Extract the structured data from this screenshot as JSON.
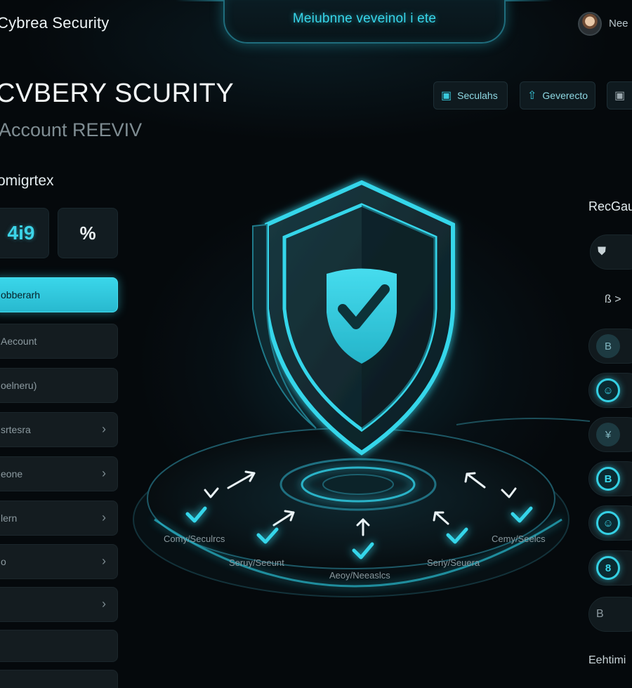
{
  "brand": "Cybrea Security",
  "top_title": "Meiubnne veveinol i ete",
  "user": {
    "name": "Nee",
    "avatar_icon": "user-avatar"
  },
  "header": {
    "title": "CVBERY SCURITY",
    "subtitle": "Account REEVIV",
    "buttons": [
      {
        "label": "Seculahs",
        "icon": "lock-icon"
      },
      {
        "label": "Geverecto",
        "icon": "cloud-upload-icon"
      },
      {
        "label": "",
        "icon": "monitor-icon"
      }
    ]
  },
  "left": {
    "section_label": "omigrtex",
    "stats": [
      {
        "value": "4i9"
      },
      {
        "value": "%"
      }
    ],
    "nav": [
      {
        "label": "obberarh",
        "active": true,
        "chevron": false
      },
      {
        "label": "Aecount",
        "active": false,
        "chevron": false
      },
      {
        "label": "oelneru)",
        "active": false,
        "chevron": false
      },
      {
        "label": "srtesra",
        "active": false,
        "chevron": true
      },
      {
        "label": "eone",
        "active": false,
        "chevron": true
      },
      {
        "label": "lern",
        "active": false,
        "chevron": true
      },
      {
        "label": "o",
        "active": false,
        "chevron": true
      },
      {
        "label": "",
        "active": false,
        "chevron": true
      },
      {
        "label": "",
        "active": false,
        "chevron": false
      },
      {
        "label": "",
        "active": false,
        "chevron": false
      }
    ]
  },
  "hero": {
    "labels": [
      "Comy/Seculrcs",
      "Seruy/Seeunt",
      "Aeoy/Neeaslcs",
      "Seriy/Seuera",
      "Cemy/Seelcs"
    ],
    "accent": "#35d6ea"
  },
  "right": {
    "title": "RecGau",
    "items": [
      {
        "icon": "shield-badge-icon",
        "glyph": "⛊",
        "style": "plain"
      },
      {
        "icon": "tag-icon",
        "glyph": "ß >",
        "style": "plain"
      },
      {
        "icon": "document-icon",
        "glyph": "B",
        "style": "dim"
      },
      {
        "icon": "face-icon",
        "glyph": "☺",
        "style": "glow"
      },
      {
        "icon": "grid-icon",
        "glyph": "¥",
        "style": "dim"
      },
      {
        "icon": "book-icon",
        "glyph": "B",
        "style": "glow"
      },
      {
        "icon": "smile-icon",
        "glyph": "☺",
        "style": "glow"
      },
      {
        "icon": "badge-icon",
        "glyph": "8",
        "style": "glow"
      },
      {
        "icon": "list-icon",
        "glyph": "B",
        "style": "plain"
      }
    ],
    "footer": "Eehtimi"
  }
}
